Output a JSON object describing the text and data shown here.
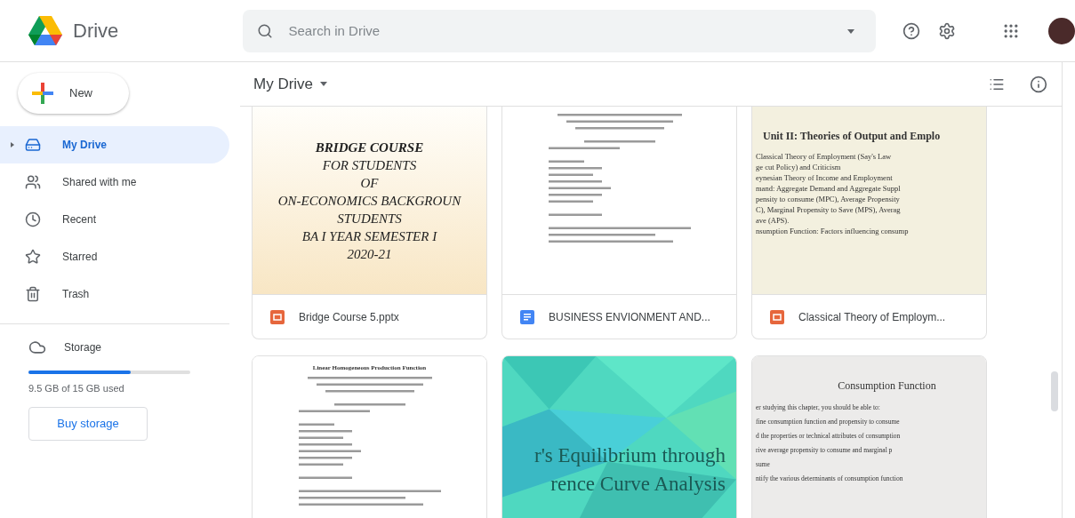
{
  "app": {
    "name": "Drive"
  },
  "search": {
    "placeholder": "Search in Drive"
  },
  "new_button": {
    "label": "New"
  },
  "sidebar": {
    "items": [
      {
        "label": "My Drive",
        "selected": true,
        "expandable": true
      },
      {
        "label": "Shared with me",
        "selected": false,
        "expandable": false
      },
      {
        "label": "Recent",
        "selected": false,
        "expandable": false
      },
      {
        "label": "Starred",
        "selected": false,
        "expandable": false
      },
      {
        "label": "Trash",
        "selected": false,
        "expandable": false
      }
    ]
  },
  "storage": {
    "label": "Storage",
    "level": 0.63,
    "usage": "9.5 GB of 15 GB used",
    "button": "Buy storage"
  },
  "breadcrumb": {
    "title": "My Drive"
  },
  "files": [
    {
      "name": "Bridge Course 5.pptx",
      "kind": "slides",
      "thumbnail": {
        "kind": "title-slide",
        "heading": "BRIDGE COURSE",
        "lines": [
          "FOR STUDENTS",
          "OF",
          "ON-ECONOMICS BACKGROUN",
          "STUDENTS",
          "BA I YEAR SEMESTER I",
          "2020-21"
        ]
      }
    },
    {
      "name": "BUSINESS ENVIONMENT AND...",
      "kind": "word",
      "thumbnail": {
        "kind": "document"
      }
    },
    {
      "name": "Classical Theory of Employm...",
      "kind": "slides",
      "thumbnail": {
        "kind": "text-slide",
        "heading": "Unit II: Theories of Output and Emplo",
        "lines": [
          "Classical Theory of Employment (Say's Law",
          "ge cut Policy) and Criticism",
          "eynesian Theory of Income and Employment",
          "mand: Aggregate Demand and Aggregate Suppl",
          "pensity to consume (MPC), Average Propensity",
          "C), Marginal Propensity to Save (MPS), Averag",
          "ave (APS).",
          "nsumption Function: Factors influencing consump"
        ]
      }
    },
    {
      "kind": "word",
      "thumbnail": {
        "kind": "document",
        "heading": "Linear Homogeneous Production Function"
      }
    },
    {
      "kind": "slides",
      "thumbnail": {
        "kind": "poly-slide",
        "lines": [
          "r's Equilibrium through",
          "rence Curve Analysis"
        ]
      }
    },
    {
      "kind": "slides",
      "thumbnail": {
        "kind": "grey-slide",
        "heading": "Consumption Function",
        "lines": [
          "er studying this chapter, you should be able to:",
          "fine consumption function and propensity to consume",
          "d the properties or technical attributes of consumption",
          "rive average propensity to consume and marginal p",
          "sume",
          "ntify the various determinants of consumption function"
        ]
      }
    }
  ]
}
